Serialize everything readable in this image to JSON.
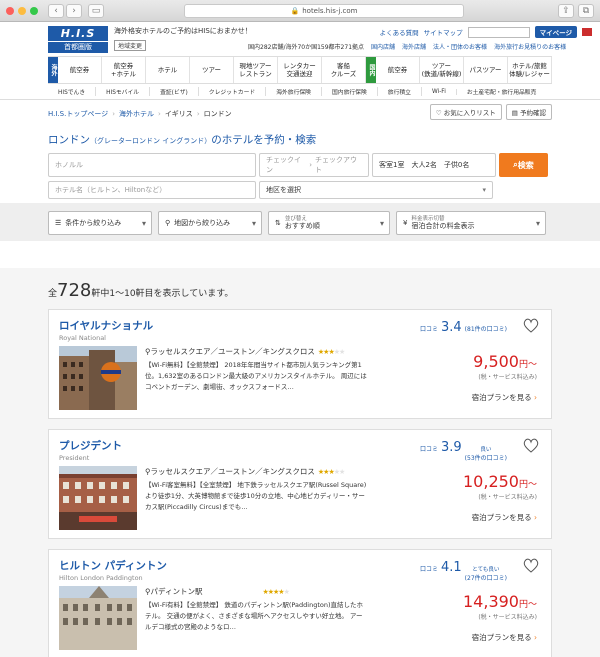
{
  "browser": {
    "url": "hotels.his-j.com"
  },
  "header": {
    "logo_text": "H.I.S",
    "logo_sub": "首都圏版",
    "catch": "海外格安ホテルのご予約はHISにおまかせ！",
    "region_change": "地域変更",
    "links": [
      "よくある質問",
      "サイトマップ"
    ],
    "mypage": "マイページ",
    "info": [
      "国内282店舗/海外70か国159都市271拠点",
      "国内店舗",
      "海外店舗",
      "法人・団体のお客様",
      "海外旅行お見積りのお客様"
    ]
  },
  "mainnav": {
    "overseas_tag": "海外",
    "domestic_tag": "国内",
    "overseas": [
      "航空券",
      "航空券\n+ホテル",
      "ホテル",
      "ツアー",
      "現地ツアー\nレストラン",
      "レンタカー\n交通送迎",
      "客船\nクルーズ"
    ],
    "domestic": [
      "航空券",
      "ツアー\n(鉄道/新幹線)",
      "パスツアー",
      "ホテル/旅館\n体験/レジャー"
    ]
  },
  "subnav": [
    "HISでんき",
    "HISモバイル",
    "査証(ビザ)",
    "クレジットカード",
    "海外旅行保険",
    "国内旅行保険",
    "旅行積立",
    "Wi-Fi",
    "お土産宅配・旅行用品販売"
  ],
  "breadcrumb": {
    "items": [
      "H.I.S.トップページ",
      "海外ホテル",
      "イギリス",
      "ロンドン"
    ],
    "fav": "お気に入りリスト",
    "confirm": "予約確認"
  },
  "search": {
    "title": "ロンドン",
    "title_sub": "（グレーターロンドン イングランド）",
    "title_suffix": "のホテルを予約・検索",
    "dest_placeholder": "ホノルル",
    "checkin": "チェックイン",
    "checkout": "チェックアウト",
    "guests": "客室1室　大人2名　子供0名",
    "search_btn": "検索",
    "name_placeholder": "ホテル名（ヒルトン、Hiltonなど）",
    "area": "地区を選択"
  },
  "filters": {
    "cond": "条件から絞り込み",
    "map": "地図から絞り込み",
    "sort_label": "並び替え",
    "sort": "おすすめ順",
    "price_label": "料金表示切替",
    "price": "宿泊合計の料金表示"
  },
  "results": {
    "prefix": "全",
    "total": "728",
    "suffix": "軒中1〜10軒目を表示しています。",
    "kuchikomi": "口コミ",
    "plan_label": "宿泊プランを見る",
    "hotels": [
      {
        "name": "ロイヤルナショナル",
        "name_en": "Royal National",
        "location": "ラッセルスクエア／ユーストン／キングスクロス",
        "stars": 3,
        "desc": "【Wi-Fi無料】【全館禁煙】 2018年年間当サイト都市別人気ランキング第1位。1,632室のあるロンドン最大級のアメリカンスタイルホテル。 周辺にはコベントガーデン、劇場街、オックスフォードス…",
        "score": "3.4",
        "count": "(81件の口コミ)",
        "comment": "",
        "price": "9,500",
        "note": "(税・サービス料込み)"
      },
      {
        "name": "プレジデント",
        "name_en": "President",
        "location": "ラッセルスクエア／ユーストン／キングスクロス",
        "stars": 3,
        "desc": "【Wi-Fi客室無料】【全室禁煙】 地下鉄ラッセルスクエア駅(Russel Square)より徒歩1分、大英博物館まで徒歩10分の立地、中心地ピカディリー・サーカス駅(Piccadilly Circus)までも…",
        "score": "3.9",
        "count": "(53件の口コミ)",
        "comment": "良い",
        "price": "10,250",
        "note": "(税・サービス料込み)"
      },
      {
        "name": "ヒルトン パディントン",
        "name_en": "Hilton London Paddington",
        "location": "パディントン駅",
        "stars": 4,
        "desc": "【Wi-Fi有料】【全館禁煙】 鉄道のパディントン駅(Paddington)直結したホテル。 交通の便がよく、さまざまな場所へアクセスしやすい好立地。 アールデコ様式の宮殿のようなロ…",
        "score": "4.1",
        "count": "(27件の口コミ)",
        "comment": "とても良い",
        "price": "14,390",
        "note": "(税・サービス料込み)"
      }
    ],
    "price_unit": "円〜"
  }
}
